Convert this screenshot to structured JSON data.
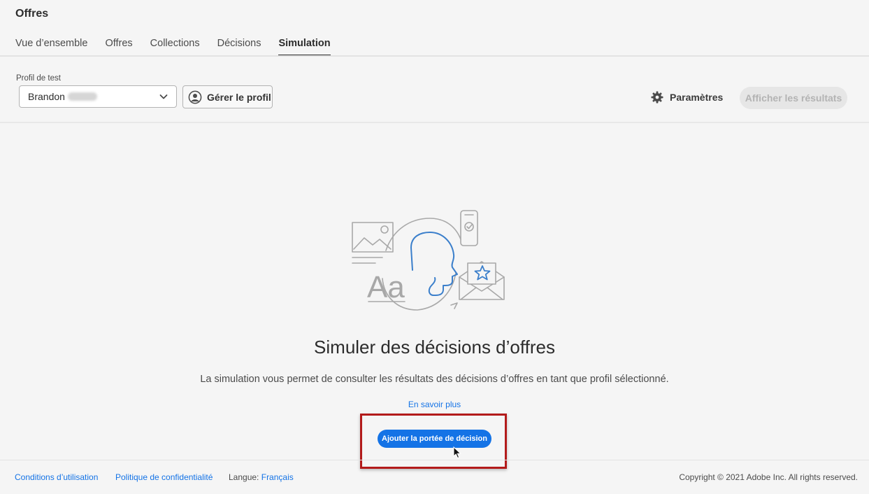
{
  "app": {
    "title": "Offres"
  },
  "tabs": [
    {
      "label": "Vue d’ensemble",
      "active": false
    },
    {
      "label": "Offres",
      "active": false
    },
    {
      "label": "Collections",
      "active": false
    },
    {
      "label": "Décisions",
      "active": false
    },
    {
      "label": "Simulation",
      "active": true
    }
  ],
  "toolbar": {
    "profile_label": "Profil de test",
    "profile_value": "Brandon",
    "manage_profile": "Gérer le profil",
    "settings": "Paramètres",
    "show_results": "Afficher les résultats"
  },
  "empty_state": {
    "title": "Simuler des décisions d’offres",
    "description": "La simulation vous permet de consulter les résultats des décisions d’offres en tant que profil sélectionné.",
    "learn_more": "En savoir plus",
    "add_scope": "Ajouter la portée de décision"
  },
  "footer": {
    "terms": "Conditions d’utilisation",
    "privacy": "Politique de confidentialité",
    "language_label": "Langue:",
    "language_value": "Français",
    "copyright": "Copyright ©  2021 Adobe Inc.  All rights reserved."
  },
  "colors": {
    "accent": "#1473e6",
    "highlight": "#b31b1b",
    "background": "#f5f5f5"
  },
  "icons": {
    "profile_dropdown": "chevron-down-icon",
    "manage_profile": "user-circle-icon",
    "settings": "gear-icon",
    "cursor": "mouse-pointer-icon"
  }
}
